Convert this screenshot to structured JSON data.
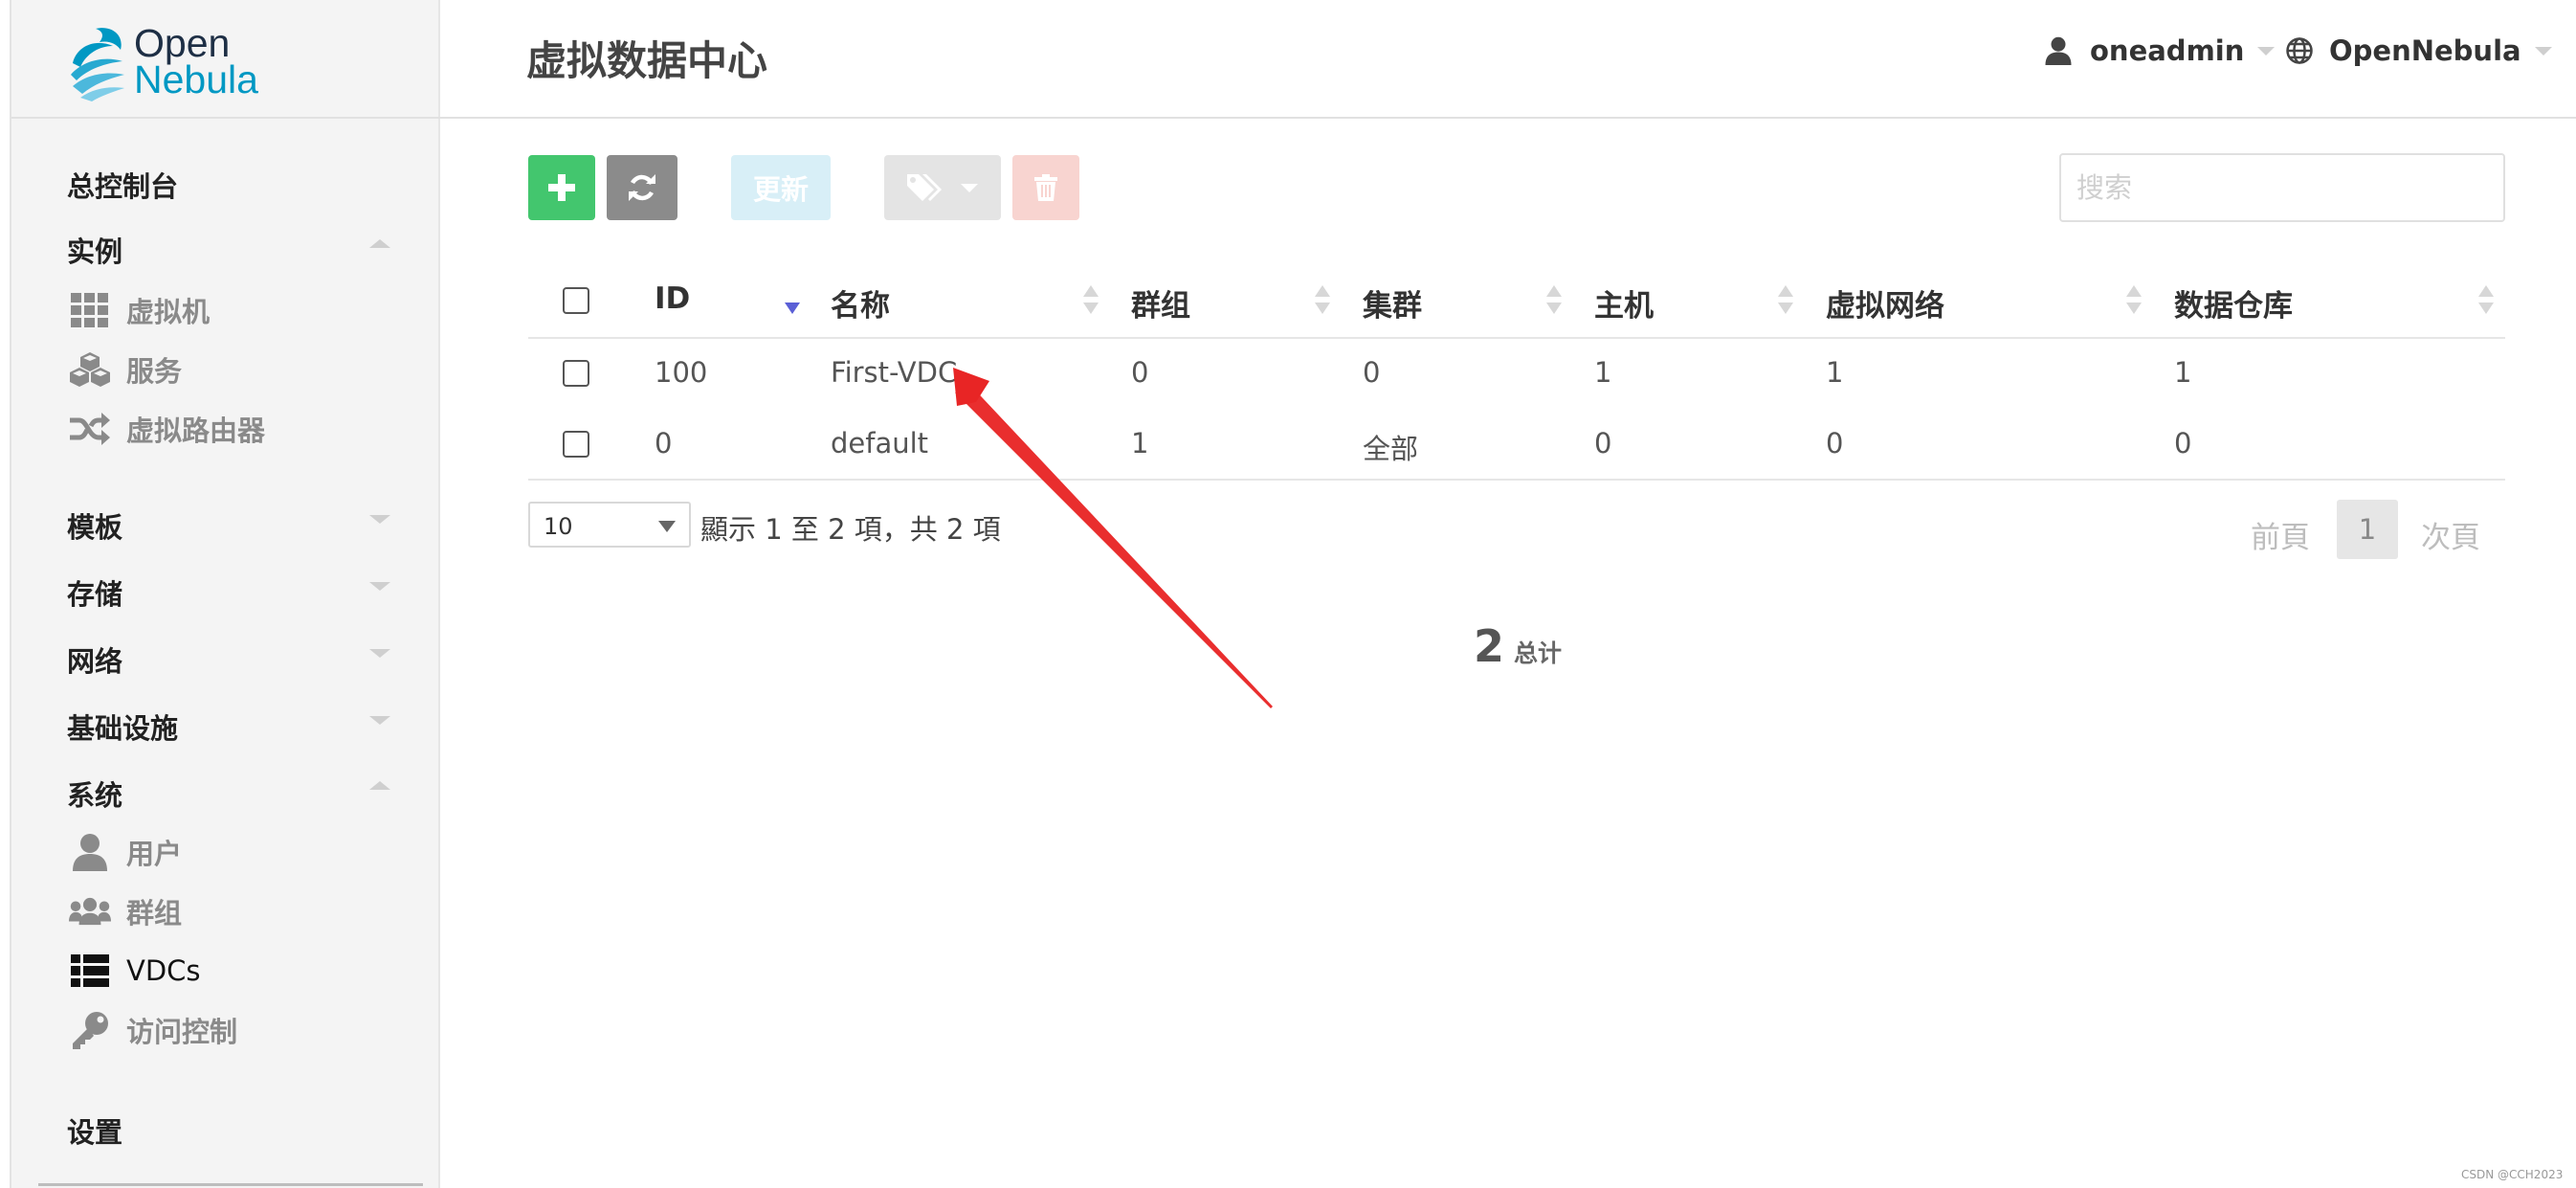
{
  "brand": {
    "line1": "Open",
    "line2": "Nebula"
  },
  "header": {
    "title": "虚拟数据中心",
    "user": "oneadmin",
    "zone": "OpenNebula"
  },
  "sidebar": {
    "dashboard": "总控制台",
    "instances": "实例",
    "instances_items": [
      {
        "label": "虚拟机",
        "icon": "grid-icon"
      },
      {
        "label": "服务",
        "icon": "cubes-icon"
      },
      {
        "label": "虚拟路由器",
        "icon": "random-icon"
      }
    ],
    "templates": "模板",
    "storage": "存储",
    "network": "网络",
    "infrastructure": "基础设施",
    "system": "系统",
    "system_items": [
      {
        "label": "用户",
        "icon": "user-icon"
      },
      {
        "label": "群组",
        "icon": "users-icon"
      },
      {
        "label": "VDCs",
        "icon": "list-icon",
        "active": true
      },
      {
        "label": "访问控制",
        "icon": "key-icon"
      }
    ],
    "settings": "设置"
  },
  "toolbar": {
    "update_label": "更新",
    "search_placeholder": "搜索"
  },
  "table": {
    "columns": [
      "ID",
      "名称",
      "群组",
      "集群",
      "主机",
      "虚拟网络",
      "数据仓库"
    ],
    "rows": [
      [
        "100",
        "First-VDC",
        "0",
        "0",
        "1",
        "1",
        "1"
      ],
      [
        "0",
        "default",
        "1",
        "全部",
        "0",
        "0",
        "0"
      ]
    ]
  },
  "footer": {
    "page_size": "10",
    "info": "顯示 1 至 2 項，共 2 項",
    "prev": "前頁",
    "page": "1",
    "next": "次頁"
  },
  "summary": {
    "count": "2",
    "label": "总计"
  },
  "watermark": "CSDN @CCH2023",
  "colors": {
    "create": "#43c66e",
    "refresh": "#8b8b8b",
    "update": "#d8eff7",
    "labels": "#e4e4e4",
    "delete": "#f8d4d0",
    "annotation_arrow": "#e82525",
    "brand_blue": "#0098c3"
  }
}
